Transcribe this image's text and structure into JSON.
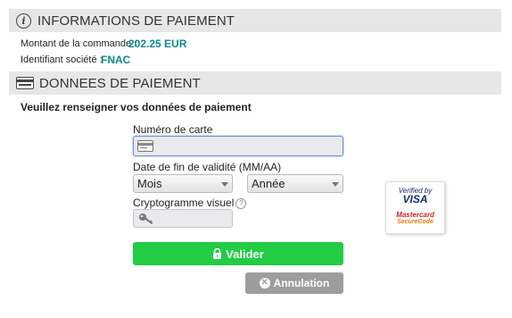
{
  "info_section": {
    "title": "INFORMATIONS DE PAIEMENT",
    "amount_label": "Montant de la commande :",
    "amount_value": "202.25 EUR",
    "company_label": "Identifiant société :",
    "company_value": "FNAC"
  },
  "payment_section": {
    "title": "DONNEES DE PAIEMENT",
    "intro": "Veuillez renseigner vos données de paiement"
  },
  "form": {
    "card_number_label": "Numéro de carte",
    "card_number_value": "",
    "expiry_label": "Date de fin de validité (MM/AA)",
    "month_selected": "Mois",
    "year_selected": "Année",
    "cvv_label": "Cryptogramme visuel",
    "cvv_help": "?",
    "cvv_value": ""
  },
  "buttons": {
    "submit": "Valider",
    "cancel": "Annulation"
  },
  "badge": {
    "verified_line1": "Verified by",
    "verified_line2": "VISA",
    "mastercard_line1": "Mastercard",
    "mastercard_line2": "SecureCode"
  },
  "colors": {
    "submit_green": "#22cc44",
    "cancel_grey": "#9d9d9d",
    "value_teal": "#0a8a8a"
  }
}
